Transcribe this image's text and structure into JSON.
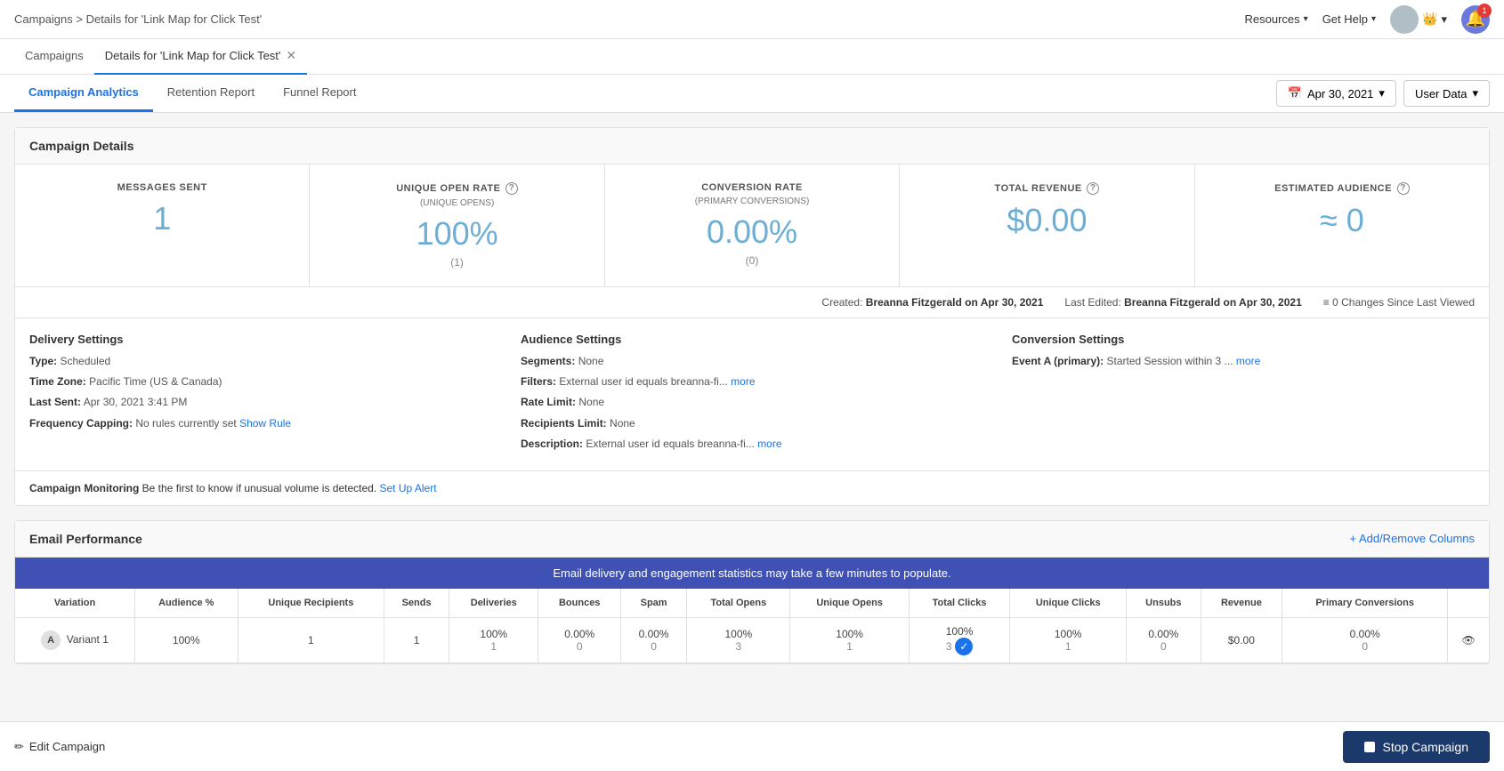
{
  "topbar": {
    "breadcrumb": "Campaigns > Details for 'Link Map for Click Test'",
    "resources_label": "Resources",
    "get_help_label": "Get Help"
  },
  "page_tabs": [
    {
      "id": "campaigns",
      "label": "Campaigns",
      "active": false,
      "closable": false
    },
    {
      "id": "details",
      "label": "Details for 'Link Map for Click Test'",
      "active": true,
      "closable": true
    }
  ],
  "section_tabs": [
    {
      "id": "campaign-analytics",
      "label": "Campaign Analytics",
      "active": true
    },
    {
      "id": "retention-report",
      "label": "Retention Report",
      "active": false
    },
    {
      "id": "funnel-report",
      "label": "Funnel Report",
      "active": false
    }
  ],
  "date_picker": {
    "label": "Apr 30, 2021",
    "calendar_icon": "📅"
  },
  "user_data": {
    "label": "User Data"
  },
  "campaign_details": {
    "header": "Campaign Details",
    "stats": [
      {
        "label": "MESSAGES SENT",
        "sublabel": "",
        "value": "1",
        "subvalue": ""
      },
      {
        "label": "UNIQUE OPEN RATE",
        "sublabel": "(UNIQUE OPENS)",
        "value": "100%",
        "subvalue": "(1)",
        "info": true
      },
      {
        "label": "CONVERSION RATE",
        "sublabel": "(PRIMARY CONVERSIONS)",
        "value": "0.00%",
        "subvalue": "(0)",
        "info": false
      },
      {
        "label": "TOTAL REVENUE",
        "sublabel": "",
        "value": "$0.00",
        "subvalue": "",
        "info": true
      },
      {
        "label": "ESTIMATED AUDIENCE",
        "sublabel": "",
        "value": "≈ 0",
        "subvalue": "",
        "info": true
      }
    ],
    "meta": {
      "created": "Created:",
      "created_by": "Breanna Fitzgerald on Apr 30, 2021",
      "last_edited": "Last Edited:",
      "last_edited_by": "Breanna Fitzgerald on Apr 30, 2021",
      "changes": "0 Changes Since Last Viewed"
    },
    "delivery_settings": {
      "title": "Delivery Settings",
      "type_label": "Type:",
      "type_value": "Scheduled",
      "timezone_label": "Time Zone:",
      "timezone_value": "Pacific Time (US & Canada)",
      "last_sent_label": "Last Sent:",
      "last_sent_value": "Apr 30, 2021 3:41 PM",
      "frequency_label": "Frequency Capping:",
      "frequency_value": "No rules currently set",
      "show_rule_link": "Show Rule"
    },
    "audience_settings": {
      "title": "Audience Settings",
      "segments_label": "Segments:",
      "segments_value": "None",
      "filters_label": "Filters:",
      "filters_value": "External user id equals breanna-fi...",
      "filters_more": "more",
      "rate_limit_label": "Rate Limit:",
      "rate_limit_value": "None",
      "recipients_limit_label": "Recipients Limit:",
      "recipients_limit_value": "None",
      "description_label": "Description:",
      "description_value": "External user id equals breanna-fi...",
      "description_more": "more"
    },
    "conversion_settings": {
      "title": "Conversion Settings",
      "event_a_label": "Event A (primary):",
      "event_a_value": "Started Session within 3 ...",
      "event_a_more": "more"
    },
    "monitoring": {
      "label": "Campaign Monitoring",
      "message": "Be the first to know if unusual volume is detected.",
      "link_label": "Set Up Alert"
    }
  },
  "email_performance": {
    "title": "Email Performance",
    "add_remove_label": "+ Add/Remove Columns",
    "info_banner": "Email delivery and engagement statistics may take a few minutes to populate.",
    "columns": [
      "Variation",
      "Audience %",
      "Unique Recipients",
      "Sends",
      "Deliveries",
      "Bounces",
      "Spam",
      "Total Opens",
      "Unique Opens",
      "Total Clicks",
      "Unique Clicks",
      "Unsubs",
      "Revenue",
      "Primary Conversions"
    ],
    "rows": [
      {
        "variant_letter": "A",
        "variant_name": "Variant 1",
        "audience_pct": "100%",
        "unique_recipients": "1",
        "sends": "1",
        "deliveries": "100%\n1",
        "bounces": "0.00%\n0",
        "spam": "0.00%\n0",
        "total_opens": "100%\n3",
        "unique_opens": "100%\n1",
        "total_clicks": "100%\n3",
        "unique_clicks": "100%\n1",
        "unsubs": "0.00%\n0",
        "revenue": "$0.00",
        "primary_conversions": "0.00%\n0"
      }
    ]
  },
  "bottom_bar": {
    "edit_label": "Edit Campaign",
    "stop_label": "Stop Campaign"
  }
}
